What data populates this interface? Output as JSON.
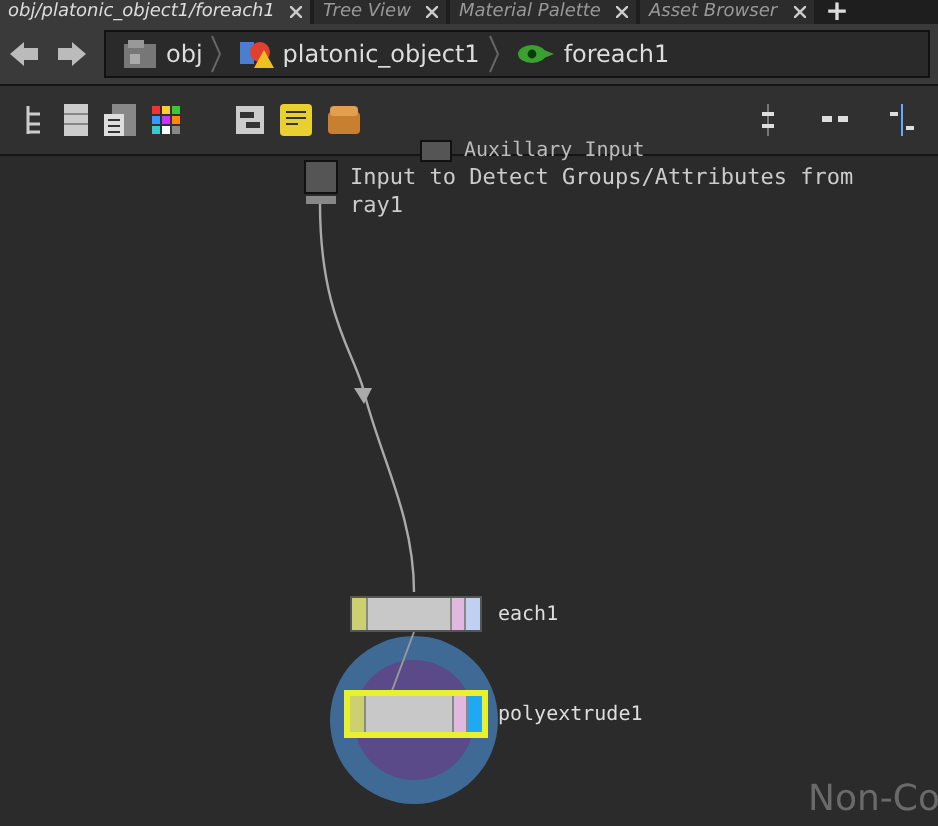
{
  "tabs": [
    {
      "label": "obj/platonic_object1/foreach1",
      "selected": true
    },
    {
      "label": "Tree View",
      "selected": false
    },
    {
      "label": "Material Palette",
      "selected": false
    },
    {
      "label": "Asset Browser",
      "selected": false
    }
  ],
  "add_tab": "+",
  "path": [
    {
      "label": "obj",
      "kind": "obj"
    },
    {
      "label": "platonic_object1",
      "kind": "geo"
    },
    {
      "label": "foreach1",
      "kind": "foreach"
    }
  ],
  "inputs": [
    {
      "label": "Auxillary Input"
    },
    {
      "label": "Input to Detect Groups/Attributes from ray1"
    }
  ],
  "nodes": [
    {
      "name": "each1",
      "selected": false
    },
    {
      "name": "polyextrude1",
      "selected": true
    }
  ],
  "license": "Non-Co"
}
